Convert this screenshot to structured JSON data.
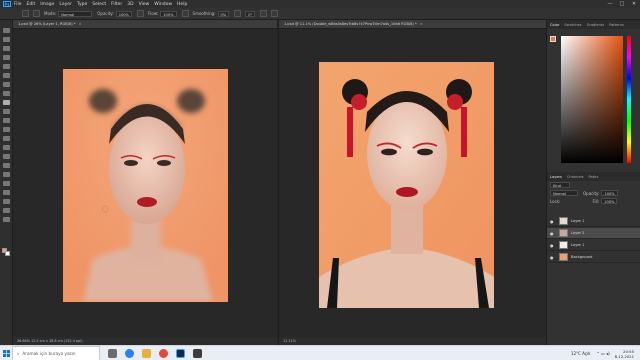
{
  "menubar": {
    "logo": "Ps",
    "items": [
      "File",
      "Edit",
      "Image",
      "Layer",
      "Type",
      "Select",
      "Filter",
      "3D",
      "View",
      "Window",
      "Help"
    ],
    "minimize": "—",
    "maximize": "□",
    "close": "✕"
  },
  "options": {
    "mode_label": "Mode:",
    "mode_value": "Normal",
    "opacity_label": "Opacity:",
    "opacity_value": "100%",
    "flow_label": "Flow:",
    "flow_value": "100%",
    "smoothing_label": "Smoothing:",
    "smoothing_value": "0%",
    "angle_value": "0°"
  },
  "documents": [
    {
      "tab_title": "1.psd @ 26% (Layer 1, RGB/8) *",
      "close": "×",
      "status": "26.66%   12.5 cm x 18.8 cm (152.4 ppi)"
    },
    {
      "tab_title": "1.psd @ 11.1% (Double_w8bs0s8es7tb8s7k7Pnw7tim7a4s_10b6 RGB/8) *",
      "close": "×",
      "status": "11.11%"
    }
  ],
  "color_panel": {
    "tabs": [
      "Color",
      "Swatches",
      "Gradients",
      "Patterns"
    ],
    "fg_color": "#e87a50",
    "hue_color": "#e5520f"
  },
  "layers_panel": {
    "tabs": [
      "Layers",
      "Channels",
      "Paths"
    ],
    "kind_label": "Kind",
    "blend_mode": "Normal",
    "opacity_label": "Opacity:",
    "opacity_value": "100%",
    "lock_label": "Lock:",
    "fill_label": "Fill:",
    "fill_value": "100%",
    "layers": [
      {
        "name": "Layer 1",
        "thumb": "#e8d8cc",
        "active": false
      },
      {
        "name": "Layer 2",
        "thumb": "#c9a99a",
        "active": true
      },
      {
        "name": "Layer 1",
        "thumb": "#f2efe9",
        "active": false
      },
      {
        "name": "Background",
        "thumb": "#f0a070",
        "active": false
      }
    ]
  },
  "taskbar": {
    "search_placeholder": "Aramak için buraya yazın",
    "weather": "12°C  Açık",
    "time": "20:55",
    "date": "8.12.2021"
  },
  "colors": {
    "app_bg": "#262626",
    "portrait_bg": "#f29a6a",
    "accent": "#31a8ff"
  }
}
